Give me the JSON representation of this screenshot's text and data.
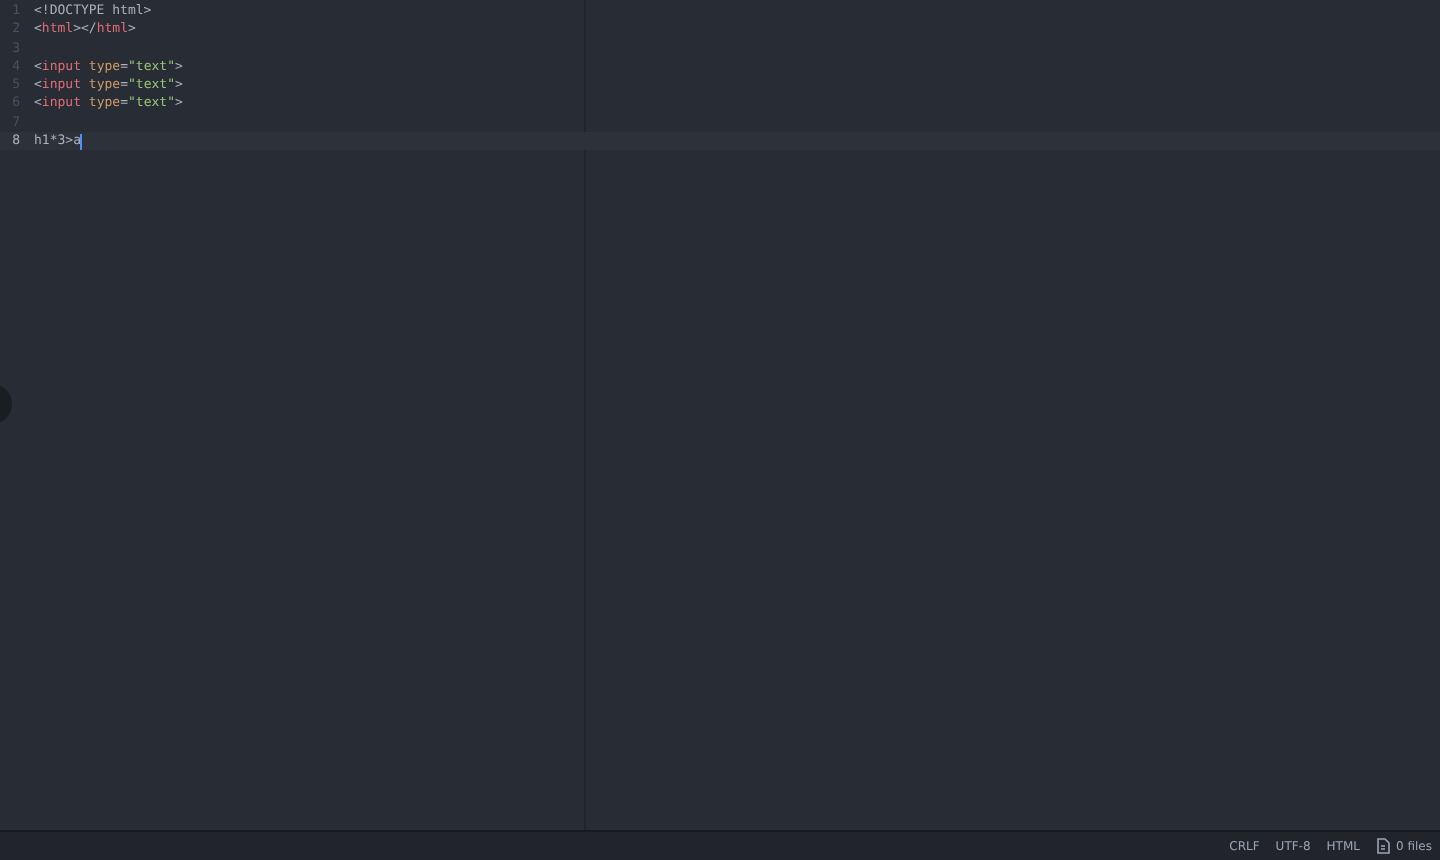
{
  "editor": {
    "lines": [
      {
        "number": "1",
        "current": false,
        "tokens": [
          {
            "kind": "text",
            "text": "<!DOCTYPE html>"
          }
        ]
      },
      {
        "number": "2",
        "current": false,
        "tokens": [
          {
            "kind": "punct",
            "text": "<"
          },
          {
            "kind": "tag",
            "text": "html"
          },
          {
            "kind": "punct",
            "text": "></"
          },
          {
            "kind": "tag",
            "text": "html"
          },
          {
            "kind": "punct",
            "text": ">"
          }
        ]
      },
      {
        "number": "3",
        "current": false
      },
      {
        "number": "4",
        "current": false,
        "tokens": [
          {
            "kind": "punct",
            "text": "<"
          },
          {
            "kind": "tag",
            "text": "input"
          },
          {
            "kind": "attr",
            "text": " type"
          },
          {
            "kind": "punct",
            "text": "="
          },
          {
            "kind": "string",
            "text": "\"text\""
          },
          {
            "kind": "punct",
            "text": ">"
          }
        ]
      },
      {
        "number": "5",
        "current": false,
        "tokens": [
          {
            "kind": "punct",
            "text": "<"
          },
          {
            "kind": "tag",
            "text": "input"
          },
          {
            "kind": "attr",
            "text": " type"
          },
          {
            "kind": "punct",
            "text": "="
          },
          {
            "kind": "string",
            "text": "\"text\""
          },
          {
            "kind": "punct",
            "text": ">"
          }
        ]
      },
      {
        "number": "6",
        "current": false,
        "tokens": [
          {
            "kind": "punct",
            "text": "<"
          },
          {
            "kind": "tag",
            "text": "input"
          },
          {
            "kind": "attr",
            "text": " type"
          },
          {
            "kind": "punct",
            "text": "="
          },
          {
            "kind": "string",
            "text": "\"text\""
          },
          {
            "kind": "punct",
            "text": ">"
          }
        ]
      },
      {
        "number": "7",
        "current": false
      },
      {
        "number": "8",
        "current": true,
        "tokens": [
          {
            "kind": "text",
            "text": "h1*3>a"
          }
        ]
      }
    ]
  },
  "status_bar": {
    "line_ending": "CRLF",
    "encoding": "UTF-8",
    "grammar": "HTML",
    "files": "0 files"
  }
}
